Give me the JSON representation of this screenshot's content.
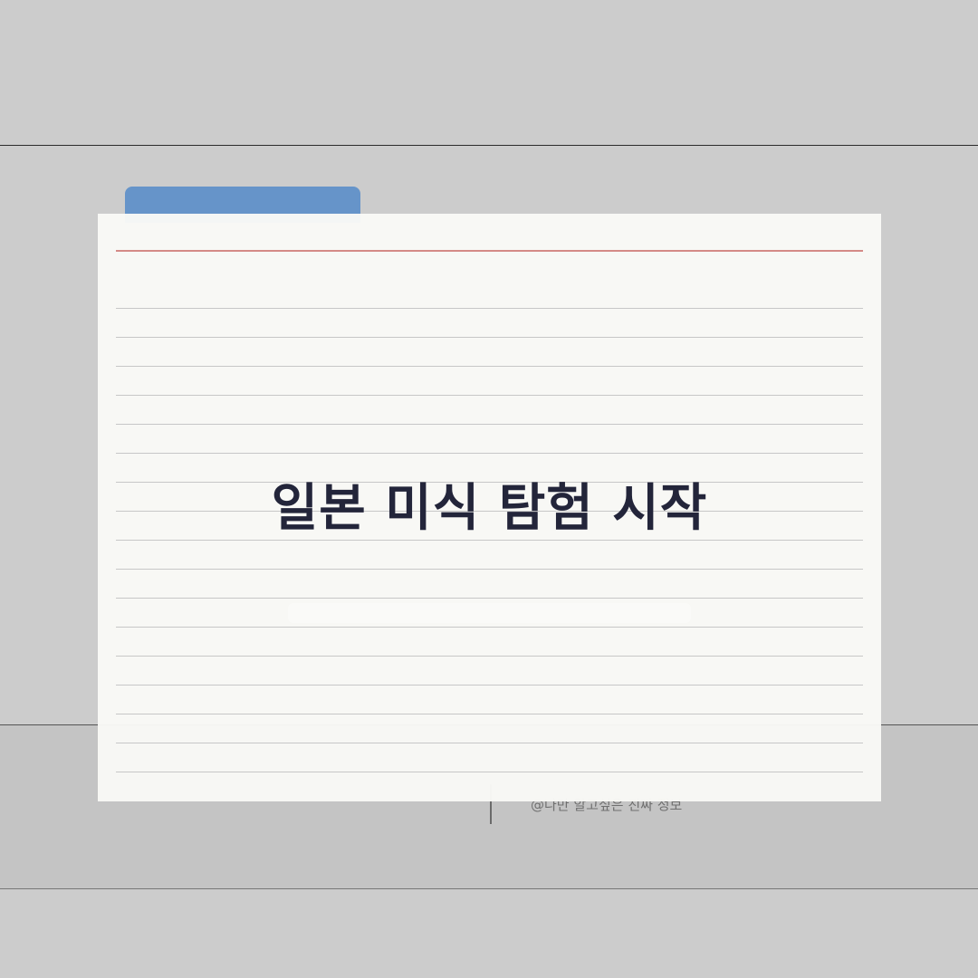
{
  "card": {
    "title": "일본 미식 탐험 시작"
  },
  "footer": {
    "credit": "@나만 알고싶은 진짜 정보"
  },
  "colors": {
    "background": "#cccccc",
    "band": "#c4c4c4",
    "tab": "#6694c9",
    "card": "#f9f9f6",
    "margin_rule": "#d48a86",
    "ruled_lines": "#c7c7c7",
    "title_text": "#23253a"
  }
}
